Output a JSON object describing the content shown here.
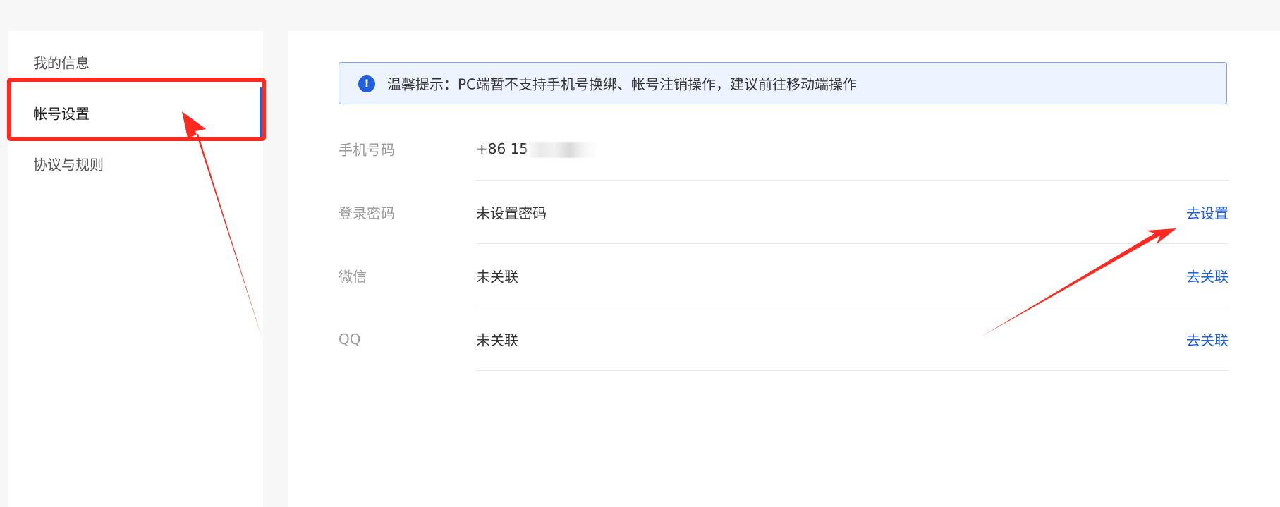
{
  "colors": {
    "accent": "#1f5fe0",
    "annotation": "#ff2a1f"
  },
  "sidebar": {
    "items": [
      {
        "label": "我的信息",
        "active": false
      },
      {
        "label": "帐号设置",
        "active": true
      },
      {
        "label": "协议与规则",
        "active": false
      }
    ]
  },
  "notice": {
    "icon": "info-icon",
    "icon_glyph": "!",
    "text": "温馨提示：PC端暂不支持手机号换绑、帐号注销操作，建议前往移动端操作"
  },
  "account": {
    "rows": [
      {
        "label": "手机号码",
        "value": "+86 15",
        "action": ""
      },
      {
        "label": "登录密码",
        "value": "未设置密码",
        "action": "去设置"
      },
      {
        "label": "微信",
        "value": "未关联",
        "action": "去关联"
      },
      {
        "label": "QQ",
        "value": "未关联",
        "action": "去关联"
      }
    ]
  }
}
